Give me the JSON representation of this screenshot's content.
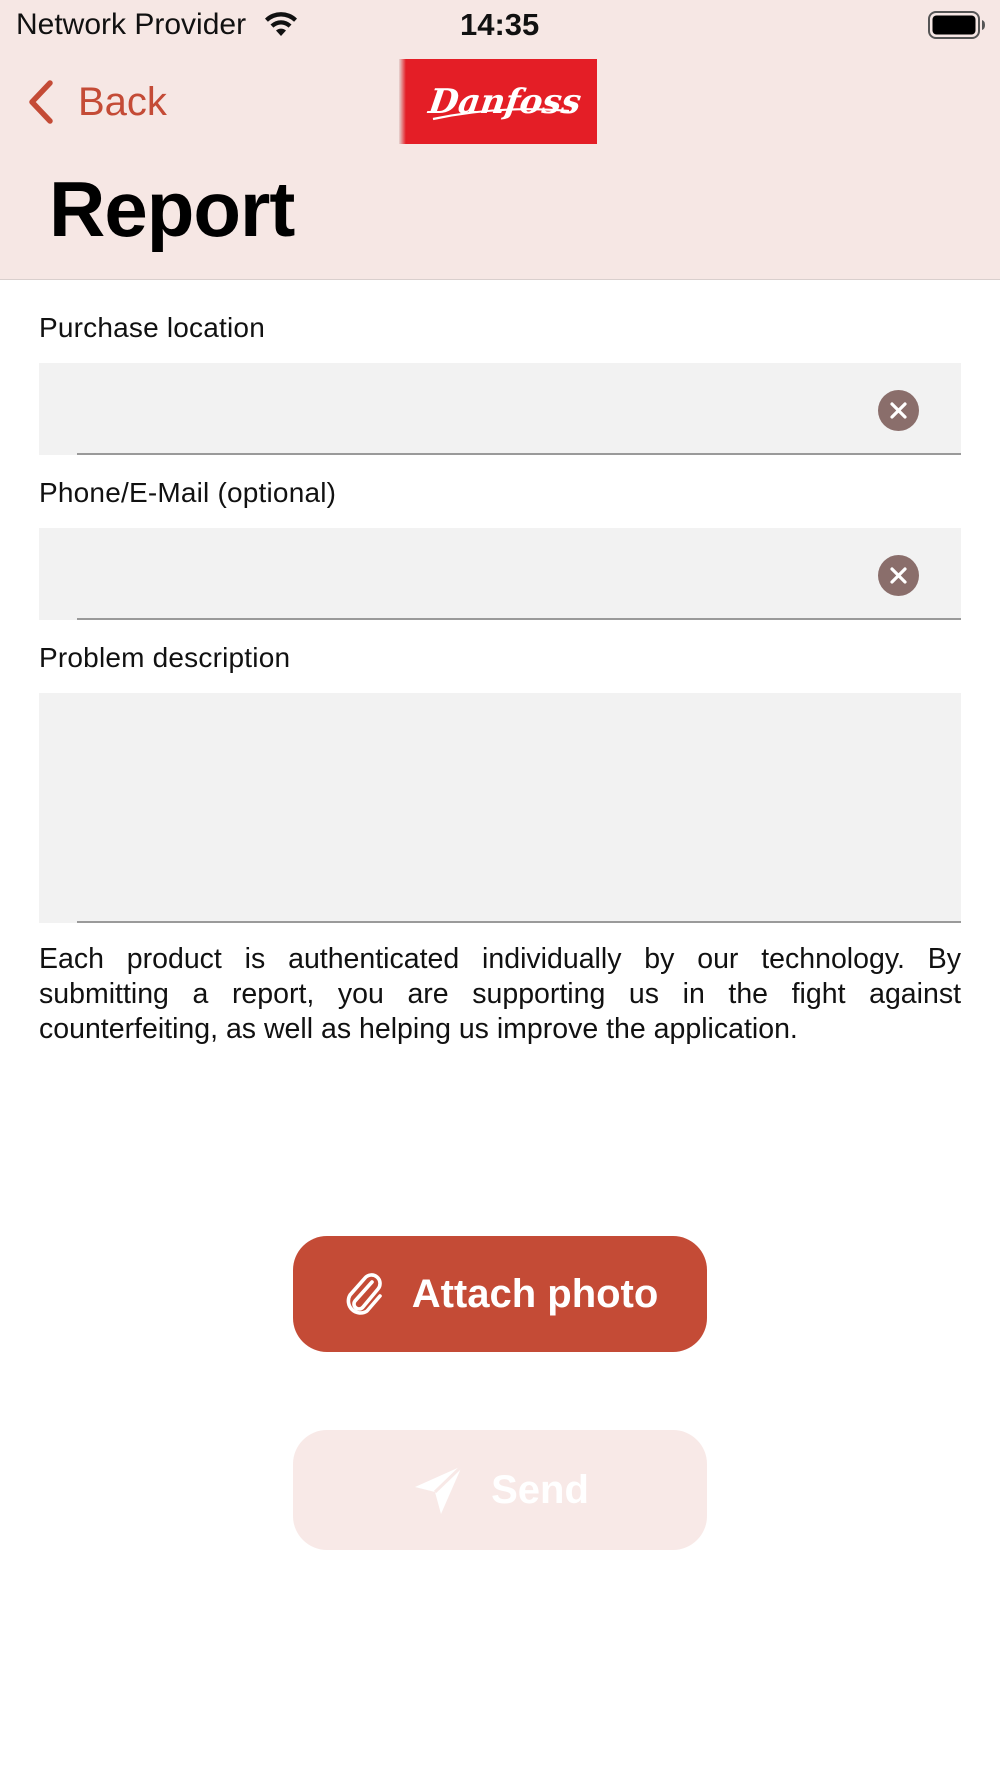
{
  "status_bar": {
    "carrier": "Network Provider",
    "time": "14:35"
  },
  "nav": {
    "back_label": "Back",
    "logo_text": "Danfoss",
    "title": "Report"
  },
  "form": {
    "purchase_location": {
      "label": "Purchase location",
      "value": "",
      "placeholder": ""
    },
    "contact": {
      "label": "Phone/E-Mail (optional)",
      "value": "",
      "placeholder": ""
    },
    "problem_description": {
      "label": "Problem description",
      "value": "",
      "placeholder": ""
    }
  },
  "info_text": "Each product is authenticated individually by our technology. By submitting a report, you are supporting us in the fight against counterfeiting, as well as helping us improve the application.",
  "buttons": {
    "attach_photo": "Attach photo",
    "send": "Send"
  },
  "icons": {
    "back": "chevron-left-icon",
    "clear": "clear-circle-icon",
    "attach": "paperclip-icon",
    "send": "paper-plane-icon",
    "wifi": "wifi-icon",
    "battery": "battery-icon"
  },
  "colors": {
    "accent": "#c44b36",
    "header_bg": "#f6e7e4",
    "field_bg": "#f2f2f2",
    "send_disabled_bg": "#f8e9e7",
    "logo_red": "#e41e26"
  }
}
